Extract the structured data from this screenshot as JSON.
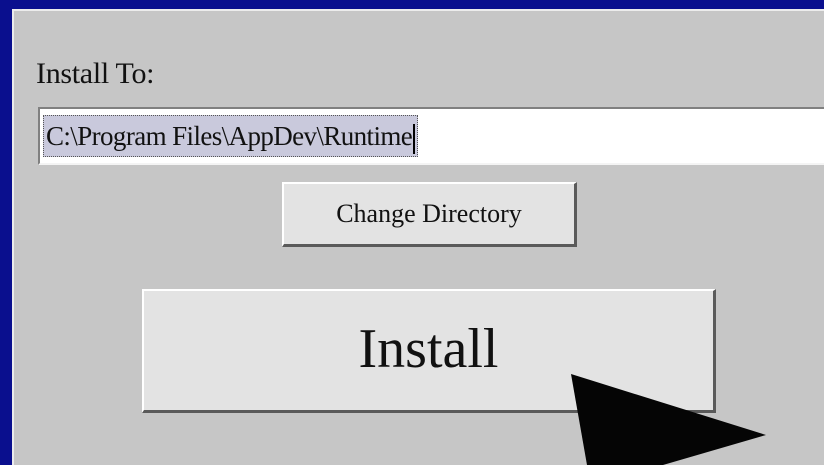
{
  "install_to": {
    "label": "Install To:",
    "path_value": "C:\\Program Files\\AppDev\\Runtime"
  },
  "buttons": {
    "change_directory": "Change Directory",
    "install": "Install"
  },
  "colors": {
    "background": "#0a0f8e",
    "panel": "#c6c6c6",
    "button_face": "#e3e3e3",
    "selection": "#c9c9dc"
  },
  "icons": {
    "pointer": "arrow-cursor-icon"
  }
}
